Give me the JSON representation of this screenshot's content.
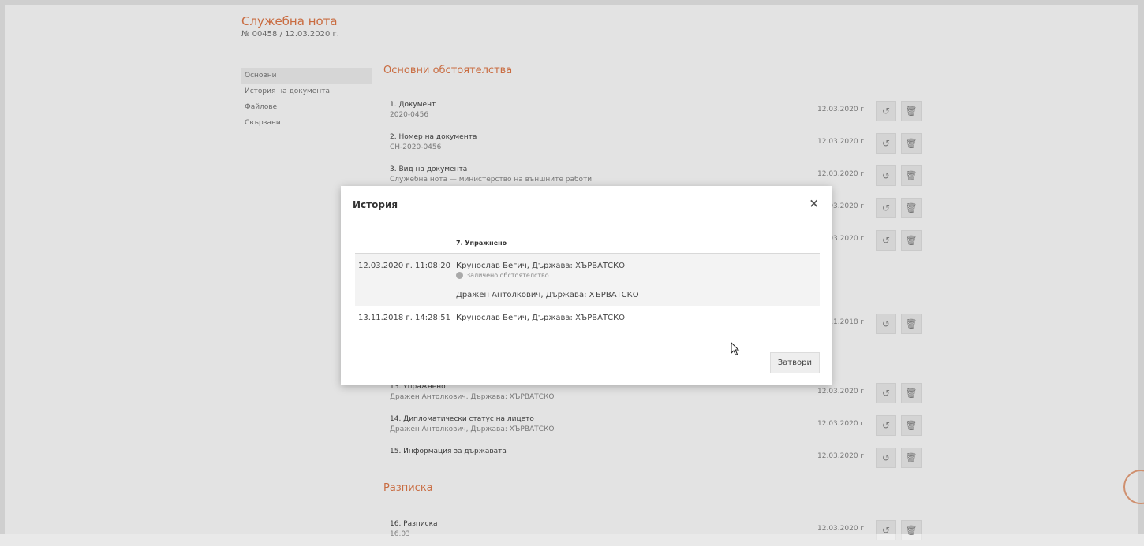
{
  "background": {
    "title": "Служебна нота",
    "subtitle": "№ 00458 / 12.03.2020 г.",
    "sidebar": [
      "Основни",
      "История на документа",
      "Файлове",
      "Свързани"
    ],
    "section1_title": "Основни обстоятелства",
    "rows": [
      {
        "t1": "1. Документ",
        "t2": "2020-0456",
        "date": "12.03.2020 г."
      },
      {
        "t1": "2. Номер на документа",
        "t2": "СН-2020-0456",
        "date": "12.03.2020 г."
      },
      {
        "t1": "3. Вид на документа",
        "t2": "Служебна нота — министерство на външните работи",
        "date": "12.03.2020 г."
      },
      {
        "t1": "",
        "t2": "",
        "date": "12.03.2020 г."
      },
      {
        "t1": "",
        "t2": "",
        "date": "12.03.2020 г."
      }
    ],
    "rows2": [
      {
        "t1": "",
        "t2": "",
        "date": "13.11.2018 г."
      }
    ],
    "rows3": [
      {
        "t1": "13. Упражнено",
        "t2": "Дражен Антолкович, Държава: ХЪРВАТСКО",
        "date": "12.03.2020 г."
      },
      {
        "t1": "14. Дипломатически статус на лицето",
        "t2": "Дражен Антолкович, Държава: ХЪРВАТСКО",
        "date": "12.03.2020 г."
      },
      {
        "t1": "15. Информация за държавата",
        "t2": "",
        "date": "12.03.2020 г."
      }
    ],
    "section2_title": "Разписка",
    "rows4": [
      {
        "t1": "16. Разписка",
        "t2": "16.03",
        "date": "12.03.2020 г."
      }
    ]
  },
  "modal": {
    "title": "История",
    "close_icon": "×",
    "column_header": "7. Упражнено",
    "rows": [
      {
        "timestamp": "12.03.2020 г. 11:08:20",
        "entry1_name": "Крунослав Бегич, Държава: ХЪРВАТСКО",
        "entry1_note": "Заличено обстоятелство",
        "entry2_name": "Дражен Антолкович, Държава: ХЪРВАТСКО"
      },
      {
        "timestamp": "13.11.2018 г. 14:28:51",
        "entry1_name": "Крунослав Бегич, Държава: ХЪРВАТСКО"
      }
    ],
    "close_button": "Затвори"
  },
  "colors": {
    "accent": "#e27a4a",
    "overlay": "rgba(0,0,0,0.11)"
  },
  "icons": {
    "history": "history-icon",
    "delete": "delete-icon",
    "note": "info-dot-icon",
    "cursor": "mouse-cursor-icon"
  }
}
